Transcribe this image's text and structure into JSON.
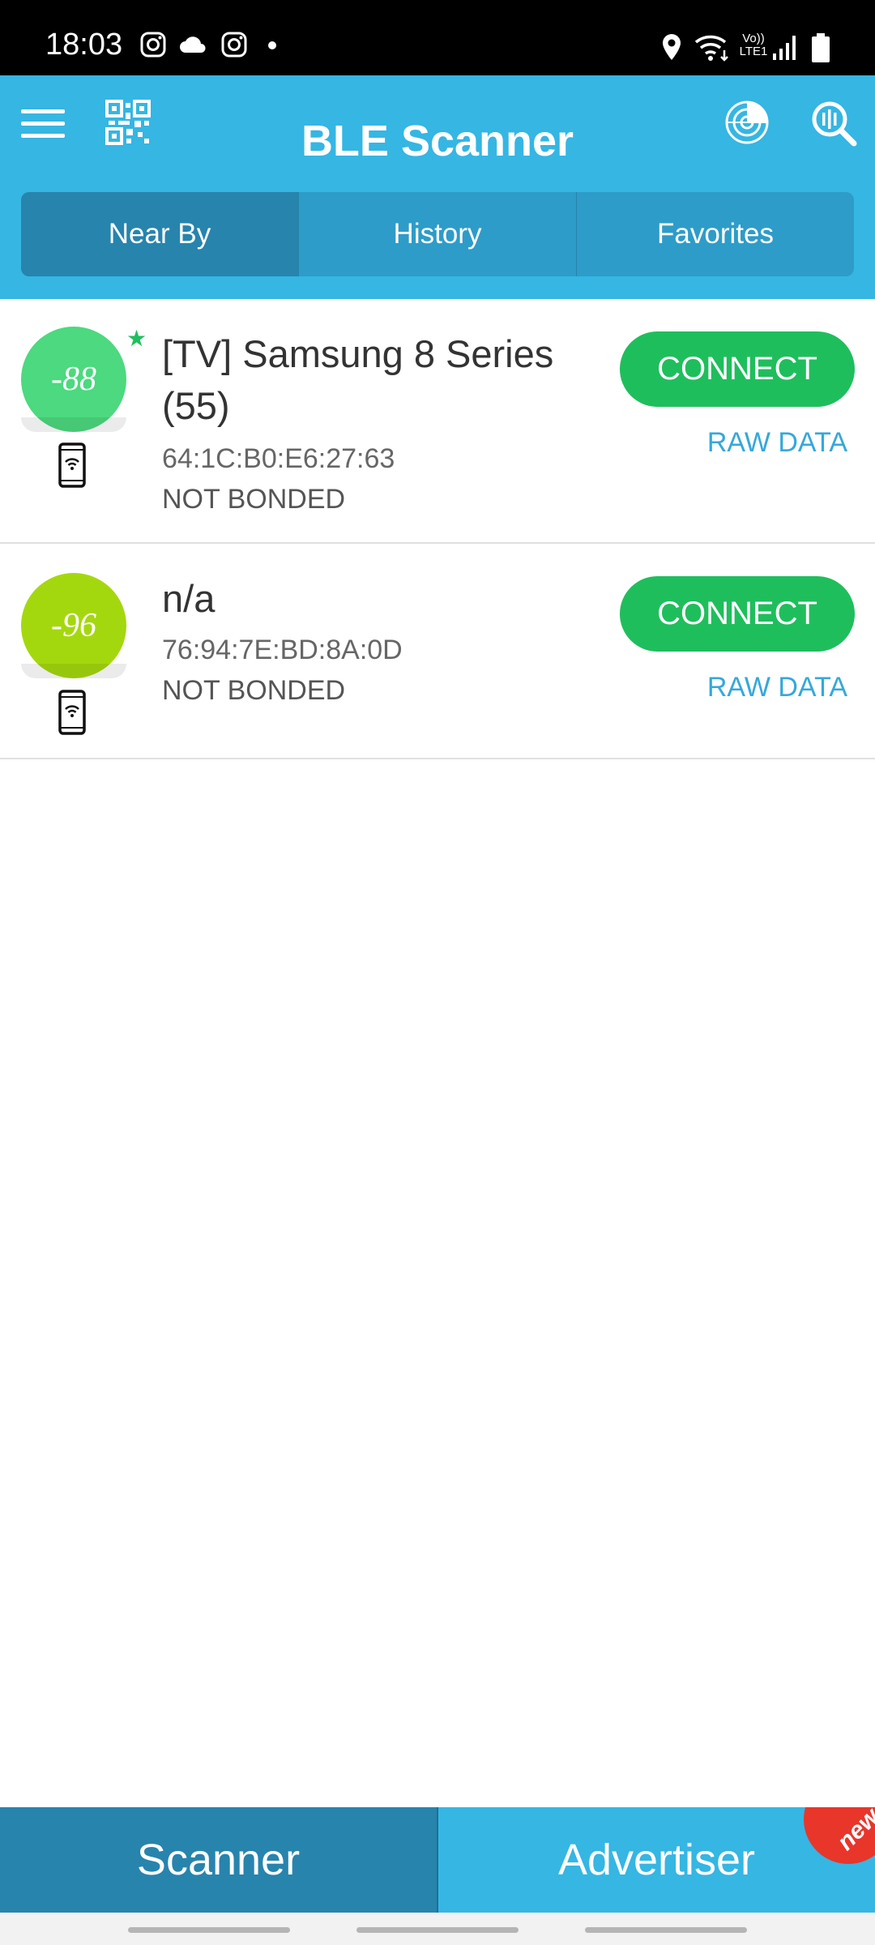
{
  "status_bar": {
    "time": "18:03",
    "left_icons": [
      "instagram-icon",
      "cloud-icon",
      "instagram-icon",
      "dot-icon"
    ],
    "right_icons": [
      "location-icon",
      "wifi-icon",
      "volte-icon",
      "signal-icon",
      "battery-icon"
    ],
    "volte_label": "Vo))",
    "lte_label": "LTE1"
  },
  "app_bar": {
    "title": "BLE Scanner",
    "icons": [
      "menu-icon",
      "qr-code-icon",
      "radar-icon",
      "search-icon"
    ]
  },
  "tabs": [
    {
      "label": "Near By",
      "active": true
    },
    {
      "label": "History",
      "active": false
    },
    {
      "label": "Favorites",
      "active": false
    }
  ],
  "devices": [
    {
      "rssi": "-88",
      "rssi_color": "#4cd97f",
      "favorite": true,
      "name_line1": "[TV] Samsung 8 Series",
      "name_line2": "(55)",
      "mac": "64:1C:B0:E6:27:63",
      "bond_state": "NOT BONDED",
      "connect_label": "CONNECT",
      "raw_label": "RAW DATA"
    },
    {
      "rssi": "-96",
      "rssi_color": "#a4d80e",
      "favorite": false,
      "name_line1": "n/a",
      "mac": "76:94:7E:BD:8A:0D",
      "bond_state": "NOT BONDED",
      "connect_label": "CONNECT",
      "raw_label": "RAW DATA"
    }
  ],
  "bottom_nav": {
    "scanner": "Scanner",
    "advertiser": "Advertiser",
    "badge": "new"
  },
  "colors": {
    "primary": "#35b6e3",
    "primary_dark": "#2784ad",
    "connect_green": "#1fbe5c",
    "raw_blue": "#35a8da",
    "badge_red": "#e8362b"
  }
}
